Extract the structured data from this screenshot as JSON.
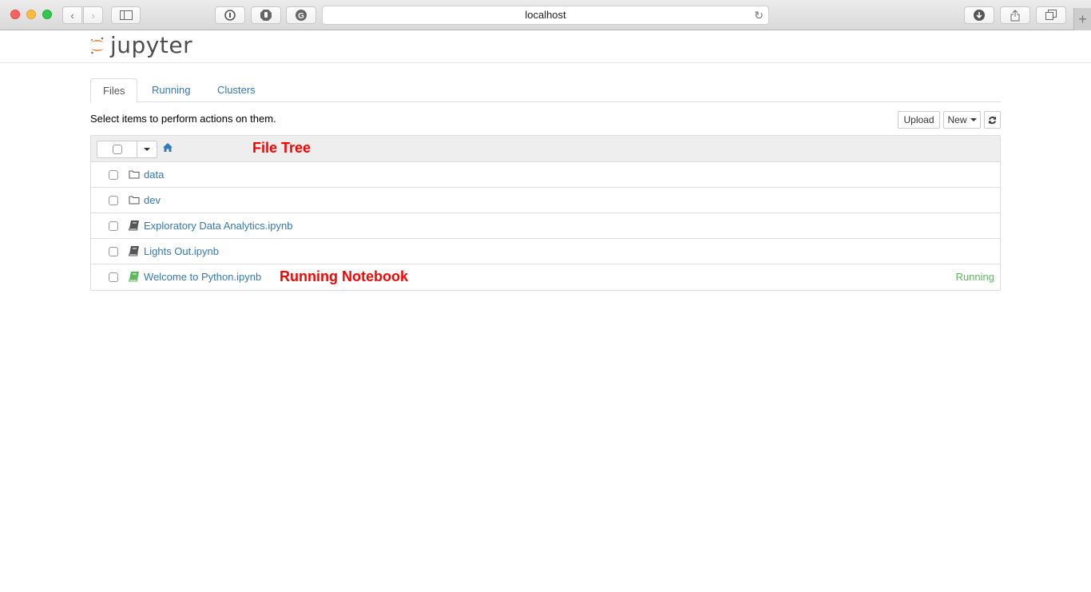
{
  "browser": {
    "url": "localhost"
  },
  "app": {
    "logo_text": "jupyter"
  },
  "tabs": [
    {
      "label": "Files",
      "active": true
    },
    {
      "label": "Running",
      "active": false
    },
    {
      "label": "Clusters",
      "active": false
    }
  ],
  "toolbar": {
    "hint": "Select items to perform actions on them.",
    "upload_label": "Upload",
    "new_label": "New"
  },
  "annotations": {
    "file_tree": "File Tree",
    "running_notebook": "Running Notebook"
  },
  "files": [
    {
      "name": "data",
      "type": "folder",
      "status": ""
    },
    {
      "name": "dev",
      "type": "folder",
      "status": ""
    },
    {
      "name": "Exploratory Data Analytics.ipynb",
      "type": "notebook",
      "status": ""
    },
    {
      "name": "Lights Out.ipynb",
      "type": "notebook",
      "status": ""
    },
    {
      "name": "Welcome to Python.ipynb",
      "type": "notebook-running",
      "status": "Running"
    }
  ],
  "colors": {
    "link": "#337ab7",
    "running": "#5cb85c",
    "annotation": "#ff0000",
    "logo_orange": "#f37726"
  }
}
